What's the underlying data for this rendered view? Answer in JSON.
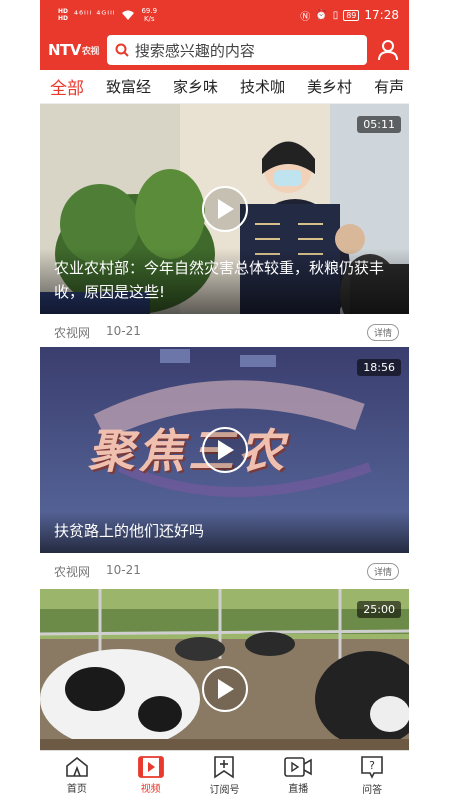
{
  "status_bar": {
    "hd1": "HD",
    "hd2": "HD",
    "signal": "⁴⁶ᴵˡˡ ⁴ᴳᴵˡˡ",
    "speed_value": "69.9",
    "speed_unit": "K/s",
    "battery": "89",
    "time": "17:28"
  },
  "header": {
    "logo": "NTV",
    "logo_sub": "农视",
    "search_placeholder": "搜索感兴趣的内容"
  },
  "tabs": [
    {
      "label": "全部",
      "active": true
    },
    {
      "label": "致富经",
      "active": false
    },
    {
      "label": "家乡味",
      "active": false
    },
    {
      "label": "技术咖",
      "active": false
    },
    {
      "label": "美乡村",
      "active": false
    },
    {
      "label": "有声",
      "active": false
    }
  ],
  "videos": [
    {
      "title": "农业农村部：今年自然灾害总体较重，秋粮仍获丰收，原因是这些!",
      "duration": "05:11",
      "source": "农视网",
      "date": "10-21",
      "detail": "详情"
    },
    {
      "title": "扶贫路上的他们还好吗",
      "duration": "18:56",
      "source": "农视网",
      "date": "10-21",
      "detail": "详情",
      "banner_text": "聚焦三农"
    },
    {
      "title": "",
      "duration": "25:00"
    }
  ],
  "bottom_nav": [
    {
      "label": "首页",
      "icon": "home-icon",
      "active": false
    },
    {
      "label": "视频",
      "icon": "video-icon",
      "active": true
    },
    {
      "label": "订阅号",
      "icon": "subscribe-icon",
      "active": false
    },
    {
      "label": "直播",
      "icon": "live-icon",
      "active": false
    },
    {
      "label": "问答",
      "icon": "qa-icon",
      "active": false
    }
  ],
  "colors": {
    "brand": "#e8392c"
  }
}
